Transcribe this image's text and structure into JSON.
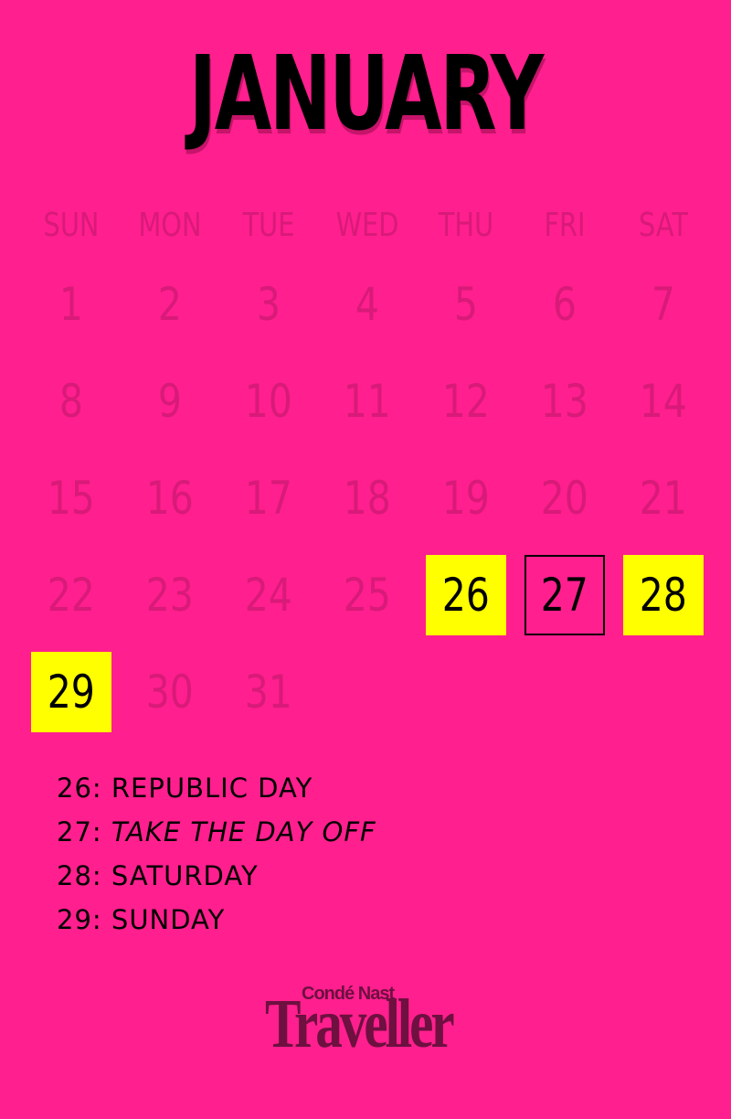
{
  "month": "JANUARY",
  "weekdays": [
    "SUN",
    "MON",
    "TUE",
    "WED",
    "THU",
    "FRI",
    "SAT"
  ],
  "days": [
    "1",
    "2",
    "3",
    "4",
    "5",
    "6",
    "7",
    "8",
    "9",
    "10",
    "11",
    "12",
    "13",
    "14",
    "15",
    "16",
    "17",
    "18",
    "19",
    "20",
    "21",
    "22",
    "23",
    "24",
    "25",
    "26",
    "27",
    "28",
    "29",
    "30",
    "31"
  ],
  "highlighted_holidays": [
    "26",
    "28",
    "29"
  ],
  "highlighted_leave": [
    "27"
  ],
  "legend": [
    {
      "date": "26",
      "desc": "REPUBLIC DAY",
      "italic": false
    },
    {
      "date": "27",
      "desc": "TAKE THE DAY OFF",
      "italic": true
    },
    {
      "date": "28",
      "desc": "SATURDAY",
      "italic": false
    },
    {
      "date": "29",
      "desc": "SUNDAY",
      "italic": false
    }
  ],
  "logo": {
    "top": "Condé Nast",
    "main": "Traveller"
  },
  "colors": {
    "background": "#ff1f8e",
    "muted_text": "#d81a79",
    "holiday_fill": "#ffff00",
    "logo": "#6e1040"
  }
}
